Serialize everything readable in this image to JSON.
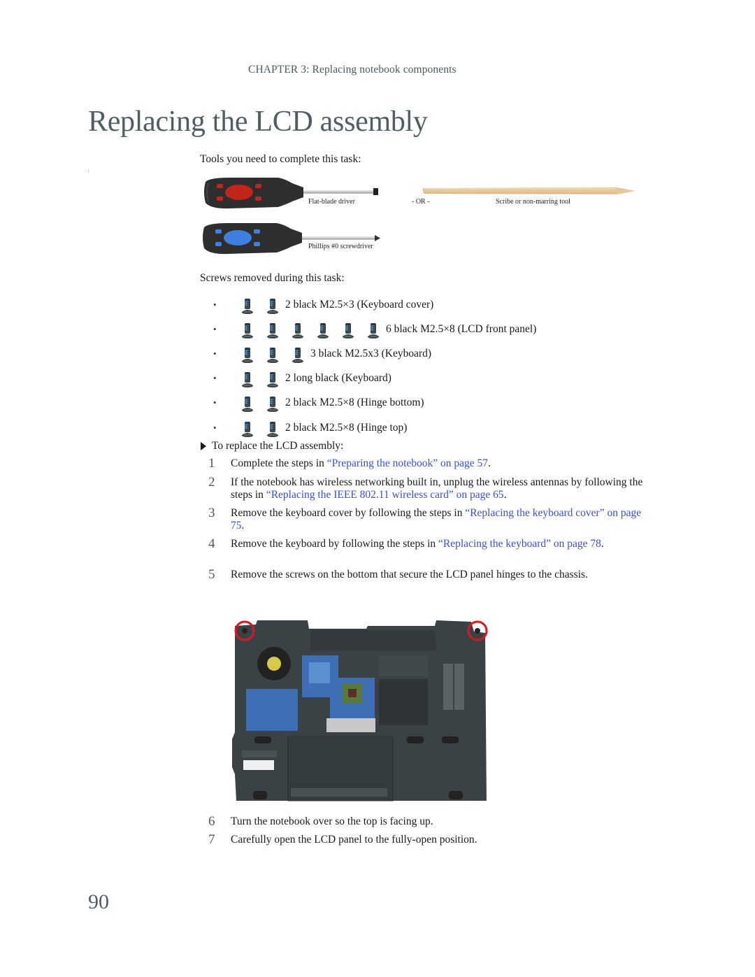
{
  "header": {
    "chapter": "CHAPTER 3: Replacing notebook components"
  },
  "title": "Replacing the LCD assembly",
  "tools": {
    "heading": "Tools you need to complete this task:",
    "items": [
      {
        "name": "flat-blade-driver",
        "label": "Flat-blade driver",
        "handle_accent": "#c0261c"
      },
      {
        "name": "scribe-tool",
        "label": "Scribe or non-marring tool",
        "color": "#e6c79a"
      },
      {
        "name": "phillips-screwdriver",
        "label": "Phillips #0 screwdriver",
        "handle_accent": "#3f7fe0"
      }
    ],
    "or_label": "- OR -"
  },
  "screws": {
    "heading": "Screws removed during this task:",
    "bullet": "•",
    "items": [
      {
        "count": 2,
        "label": "2 black M2.5×3 (Keyboard cover)"
      },
      {
        "count": 6,
        "label": "6 black M2.5×8 (LCD front panel)"
      },
      {
        "count": 3,
        "label": "3 black M2.5x3 (Keyboard)"
      },
      {
        "count": 2,
        "label": "2 long black (Keyboard)"
      },
      {
        "count": 2,
        "label": "2 black M2.5×8 (Hinge bottom)"
      },
      {
        "count": 2,
        "label": "2 black M2.5×8 (Hinge top)"
      }
    ]
  },
  "procedure": {
    "heading": "To replace the LCD assembly:",
    "steps": [
      {
        "num": "1",
        "pre": "Complete the steps in ",
        "link": "“Preparing the notebook” on page 57",
        "post": "."
      },
      {
        "num": "2",
        "pre": "If the notebook has wireless networking built in, unplug the wireless antennas by following the steps in ",
        "link": "“Replacing the IEEE 802.11 wireless card” on page 65",
        "post": "."
      },
      {
        "num": "3",
        "pre": "Remove the keyboard cover by following the steps in ",
        "link": "“Replacing the keyboard cover” on page 75",
        "post": "."
      },
      {
        "num": "4",
        "pre": "Remove the keyboard by following the steps in ",
        "link": "“Replacing the keyboard” on page 78",
        "post": "."
      },
      {
        "num": "5",
        "pre": "Remove the screws on the bottom that secure the LCD panel hinges to the chassis.",
        "link": "",
        "post": ""
      },
      {
        "num": "6",
        "pre": "Turn the notebook over so the top is facing up.",
        "link": "",
        "post": ""
      },
      {
        "num": "7",
        "pre": "Carefully open the LCD panel to the fully-open position.",
        "link": "",
        "post": ""
      }
    ]
  },
  "photo": {
    "description": "Notebook bottom view with hinge screws circled",
    "highlight_color": "#d7191f"
  },
  "colors": {
    "link": "#3a4fd8",
    "heading": "#4f5f61"
  },
  "page_number": "90"
}
